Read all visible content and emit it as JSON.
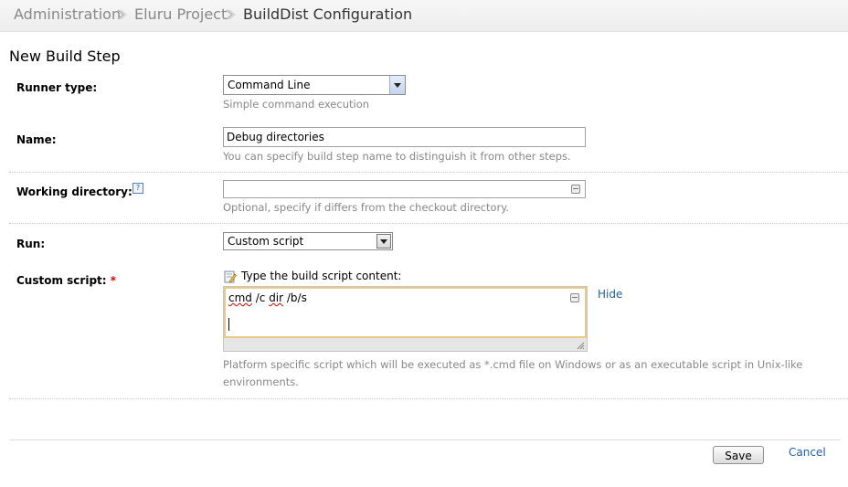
{
  "breadcrumb": {
    "items": [
      "Administration",
      "Eluru Project",
      "BuildDist Configuration"
    ]
  },
  "page_title": "New Build Step",
  "runner_type": {
    "label": "Runner type:",
    "value": "Command Line",
    "hint": "Simple command execution"
  },
  "name": {
    "label": "Name:",
    "value": "Debug directories",
    "hint": "You can specify build step name to distinguish it from other steps."
  },
  "working_directory": {
    "label": "Working directory:",
    "help_icon": "help-icon",
    "value": "",
    "hint": "Optional, specify if differs from the checkout directory."
  },
  "run": {
    "label": "Run:",
    "value": "Custom script"
  },
  "custom_script": {
    "label": "Custom script:",
    "required_mark": "*",
    "editor_icon": "edit-icon",
    "editor_label": "Type the build script content:",
    "script_words": [
      "cmd",
      " /c ",
      "dir",
      " /b/s"
    ],
    "hide_link": "Hide",
    "hint_line1": "Platform specific script which will be executed as *.cmd file on Windows or as an executable script in Unix-like",
    "hint_line2": "environments."
  },
  "footer": {
    "save_label": "Save",
    "cancel_label": "Cancel"
  },
  "colors": {
    "link": "#1f5ea8",
    "required": "#dd0000",
    "textarea_focus_border": "#e9c985"
  }
}
